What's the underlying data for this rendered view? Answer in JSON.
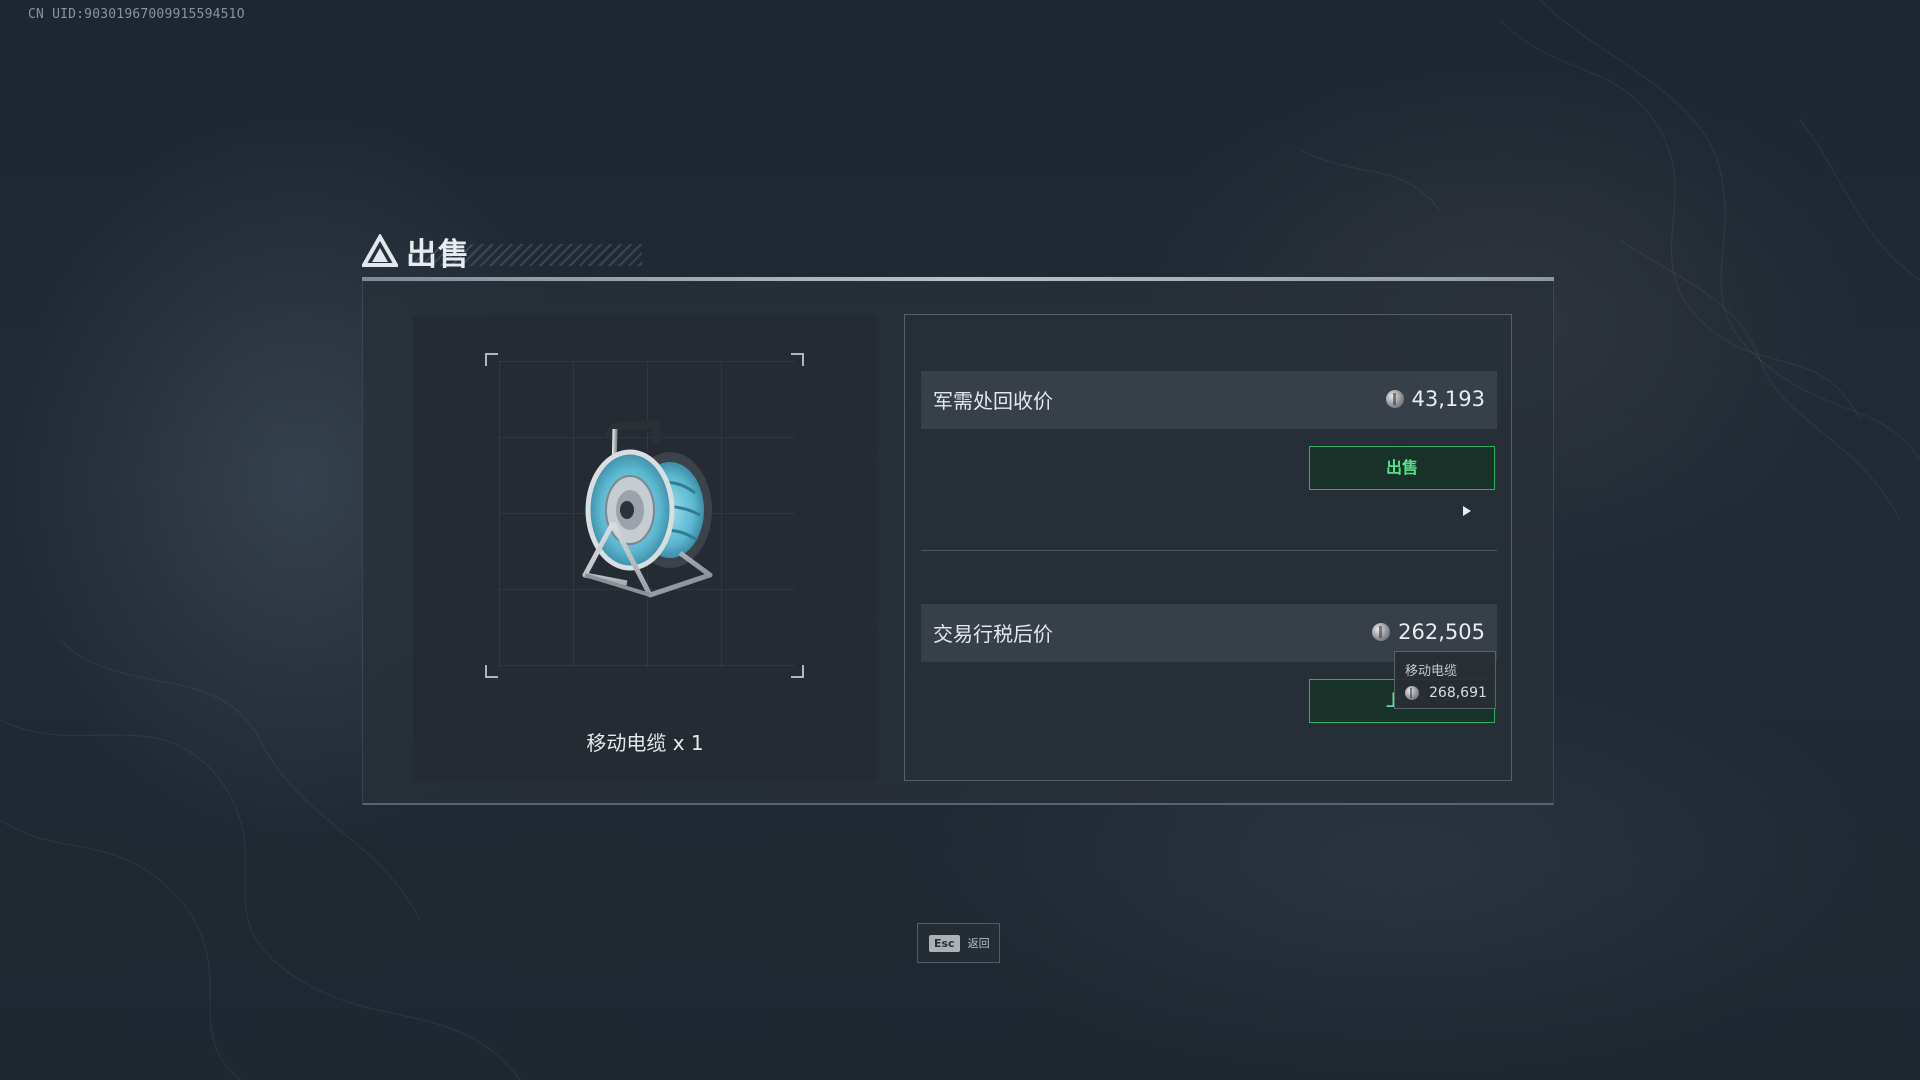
{
  "uid_label": "CN UID:9030196700991559451O",
  "header": {
    "title": "出售",
    "logo_icon": "triangle-logo-icon"
  },
  "item": {
    "name": "移动电缆 x 1",
    "image": "cable-reel-icon"
  },
  "prices": [
    {
      "label": "军需处回收价",
      "value": "43,193",
      "button_label": "出售"
    },
    {
      "label": "交易行税后价",
      "value": "262,505",
      "button_label": "上"
    }
  ],
  "tooltip": {
    "name": "移动电缆",
    "value": "268,691"
  },
  "footer": {
    "key": "Esc",
    "label": "返回"
  },
  "colors": {
    "accent_green": "#57e08a",
    "button_border": "#2fae62",
    "panel_bg": "#283038"
  }
}
